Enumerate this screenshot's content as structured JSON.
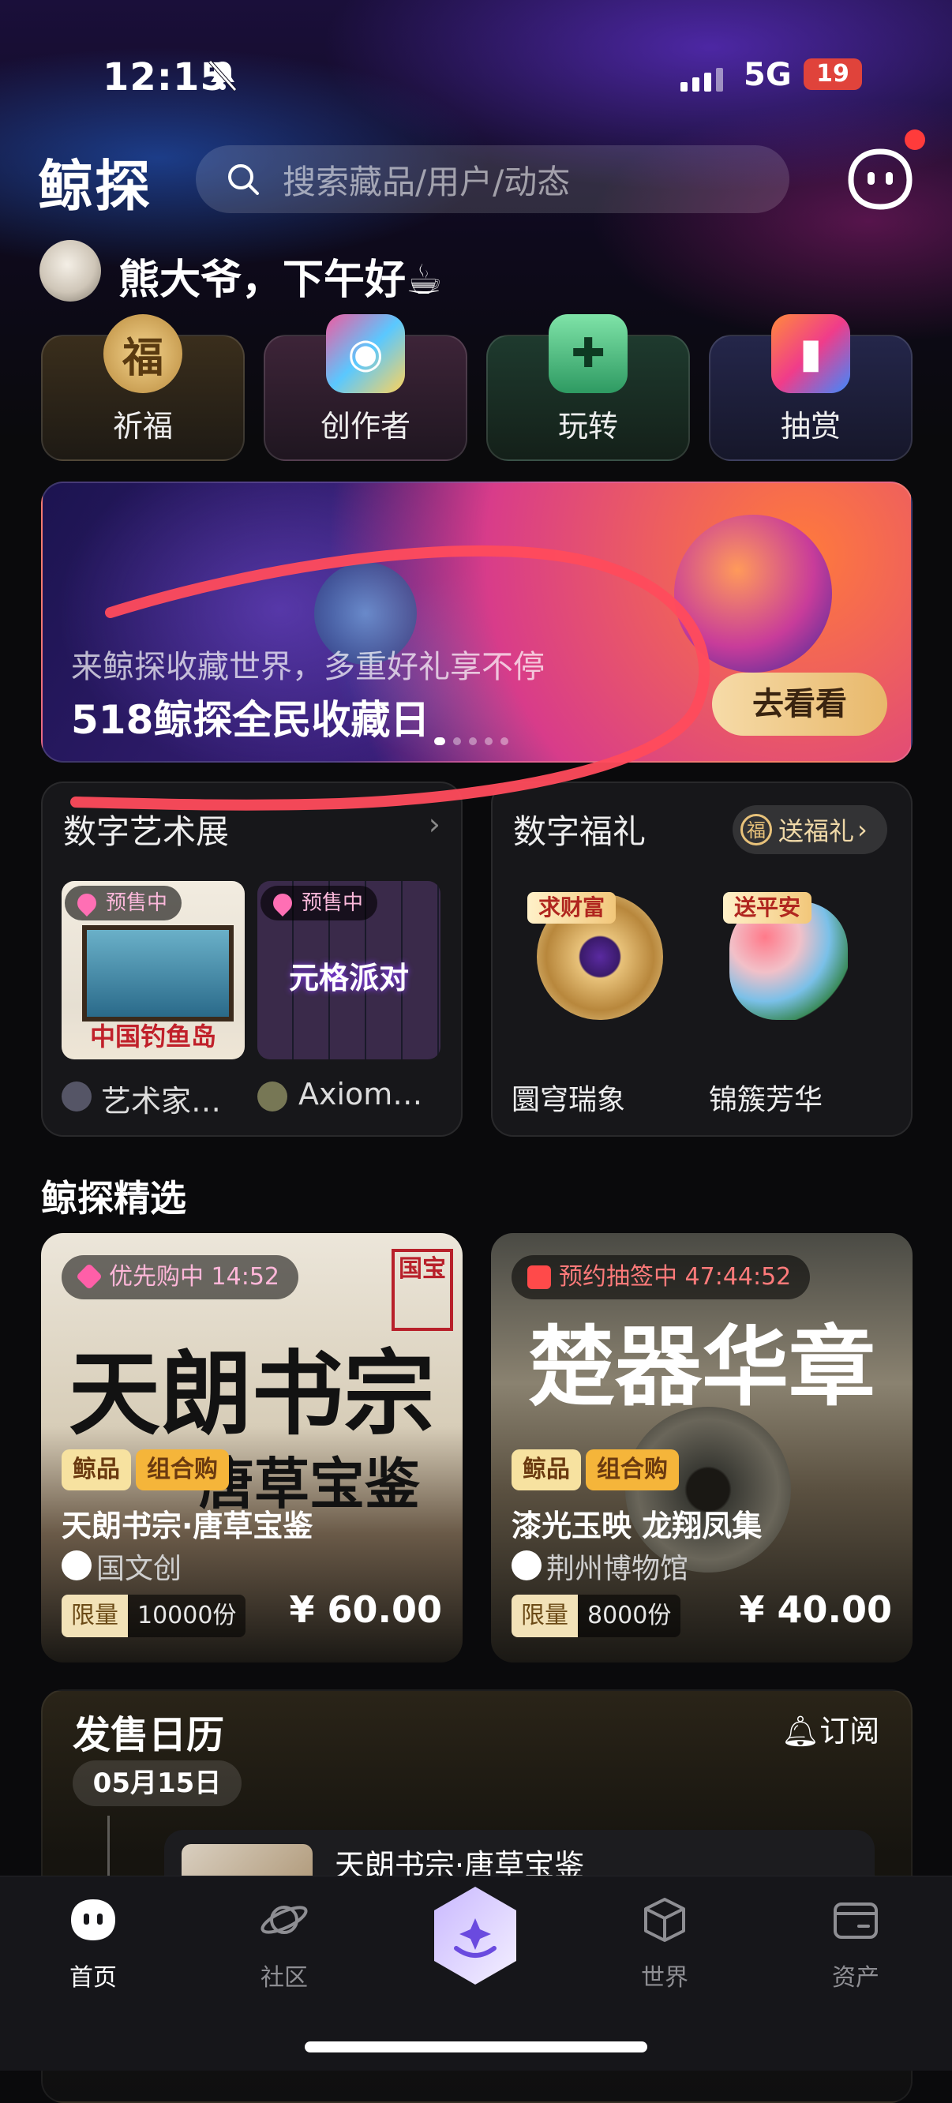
{
  "status_bar": {
    "time": "12:15",
    "network": "5G",
    "battery": "19"
  },
  "header": {
    "logo": "鲸探",
    "search_placeholder": "搜索藏品/用户/动态"
  },
  "greeting": {
    "text": "熊大爷，下午好☕"
  },
  "quick_tiles": [
    {
      "label": "祈福",
      "icon": "fortune-seal-icon"
    },
    {
      "label": "创作者",
      "icon": "creator-statue-icon"
    },
    {
      "label": "玩转",
      "icon": "game-frog-icon"
    },
    {
      "label": "抽赏",
      "icon": "cards-icon"
    }
  ],
  "banner": {
    "subtitle": "来鲸探收藏世界，多重好礼享不停",
    "title": "518鲸探全民收藏日",
    "button": "去看看"
  },
  "art_exhibit": {
    "title": "数字艺术展",
    "items": [
      {
        "badge": "预售中",
        "art_text": "中国钓鱼岛",
        "creator": "艺术家…"
      },
      {
        "badge": "预售中",
        "art_text": "元格派对",
        "creator": "Axiom…"
      }
    ]
  },
  "digital_gifts": {
    "title": "数字福礼",
    "send_label": "送福礼",
    "items": [
      {
        "tag": "求财富",
        "name": "圜穹瑞象"
      },
      {
        "tag": "送平安",
        "name": "锦簇芳华"
      }
    ]
  },
  "featured": {
    "title": "鲸探精选",
    "products": [
      {
        "status": "优先购中 14:52",
        "art_title": "天朗书宗",
        "art_sub": "唐草宝鉴",
        "tags": [
          "鲸品",
          "组合购"
        ],
        "name": "天朗书宗·唐草宝鉴",
        "publisher": "国文创",
        "limit_label": "限量",
        "limit_count": "10000份",
        "price": "¥ 60.00"
      },
      {
        "status": "预约抽签中 47:44:52",
        "art_title": "楚器华章",
        "art_sub": "",
        "tags": [
          "鲸品",
          "组合购"
        ],
        "name": "漆光玉映 龙翔凤集",
        "publisher": "荆州博物馆",
        "limit_label": "限量",
        "limit_count": "8000份",
        "price": "¥ 40.00"
      }
    ]
  },
  "calendar": {
    "title": "发售日历",
    "subscribe": "订阅",
    "date": "05月15日",
    "item_name": "天朗书宗·唐草宝鉴"
  },
  "tabbar": [
    {
      "label": "首页",
      "active": true
    },
    {
      "label": "社区",
      "active": false
    },
    {
      "label": "",
      "active": false
    },
    {
      "label": "世界",
      "active": false
    },
    {
      "label": "资产",
      "active": false
    }
  ],
  "colors": {
    "accent_gold": "#e8b86b",
    "red_dot": "#ff3b3b",
    "background": "#0a0a0c",
    "scribble": "#ff4b5c"
  }
}
